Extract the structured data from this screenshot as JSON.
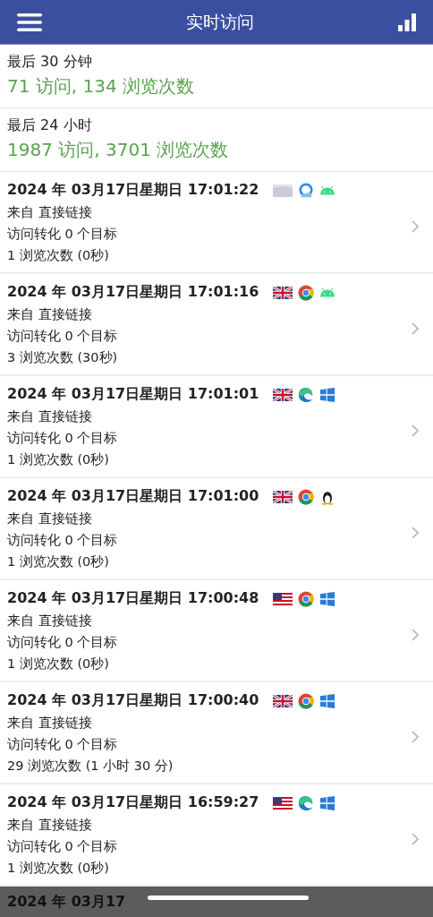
{
  "header": {
    "title": "实时访问"
  },
  "summaries": [
    {
      "label": "最后 30 分钟",
      "value": "71 访问, 134 浏览次数"
    },
    {
      "label": "最后 24 小时",
      "value": "1987 访问, 3701 浏览次数"
    }
  ],
  "visits": [
    {
      "time": "2024 年 03月17日星期日 17:01:22",
      "icons": [
        {
          "kind": "blankflag"
        },
        {
          "kind": "cloud"
        },
        {
          "kind": "android"
        }
      ],
      "source": "来自 直接链接",
      "conversion": "访问转化 0 个目标",
      "views": "1 浏览次数 (0秒)"
    },
    {
      "time": "2024 年 03月17日星期日 17:01:16",
      "icons": [
        {
          "kind": "ukflag"
        },
        {
          "kind": "chrome"
        },
        {
          "kind": "android"
        }
      ],
      "source": "来自 直接链接",
      "conversion": "访问转化 0 个目标",
      "views": "3 浏览次数 (30秒)"
    },
    {
      "time": "2024 年 03月17日星期日 17:01:01",
      "icons": [
        {
          "kind": "ukflag"
        },
        {
          "kind": "edge"
        },
        {
          "kind": "windows"
        }
      ],
      "source": "来自 直接链接",
      "conversion": "访问转化 0 个目标",
      "views": "1 浏览次数 (0秒)"
    },
    {
      "time": "2024 年 03月17日星期日 17:01:00",
      "icons": [
        {
          "kind": "ukflag"
        },
        {
          "kind": "chrome"
        },
        {
          "kind": "linux"
        }
      ],
      "source": "来自 直接链接",
      "conversion": "访问转化 0 个目标",
      "views": "1 浏览次数 (0秒)"
    },
    {
      "time": "2024 年 03月17日星期日 17:00:48",
      "icons": [
        {
          "kind": "usflag"
        },
        {
          "kind": "chrome"
        },
        {
          "kind": "windows"
        }
      ],
      "source": "来自 直接链接",
      "conversion": "访问转化 0 个目标",
      "views": "1 浏览次数 (0秒)"
    },
    {
      "time": "2024 年 03月17日星期日 17:00:40",
      "icons": [
        {
          "kind": "ukflag"
        },
        {
          "kind": "chrome"
        },
        {
          "kind": "windows"
        }
      ],
      "source": "来自 直接链接",
      "conversion": "访问转化 0 个目标",
      "views": "29 浏览次数 (1 小时 30 分)"
    },
    {
      "time": "2024 年 03月17日星期日 16:59:27",
      "icons": [
        {
          "kind": "usflag"
        },
        {
          "kind": "edge"
        },
        {
          "kind": "windows"
        }
      ],
      "source": "来自 直接链接",
      "conversion": "访问转化 0 个目标",
      "views": "1 浏览次数 (0秒)"
    }
  ],
  "partial_row": {
    "time": "2024 年 03月17"
  }
}
